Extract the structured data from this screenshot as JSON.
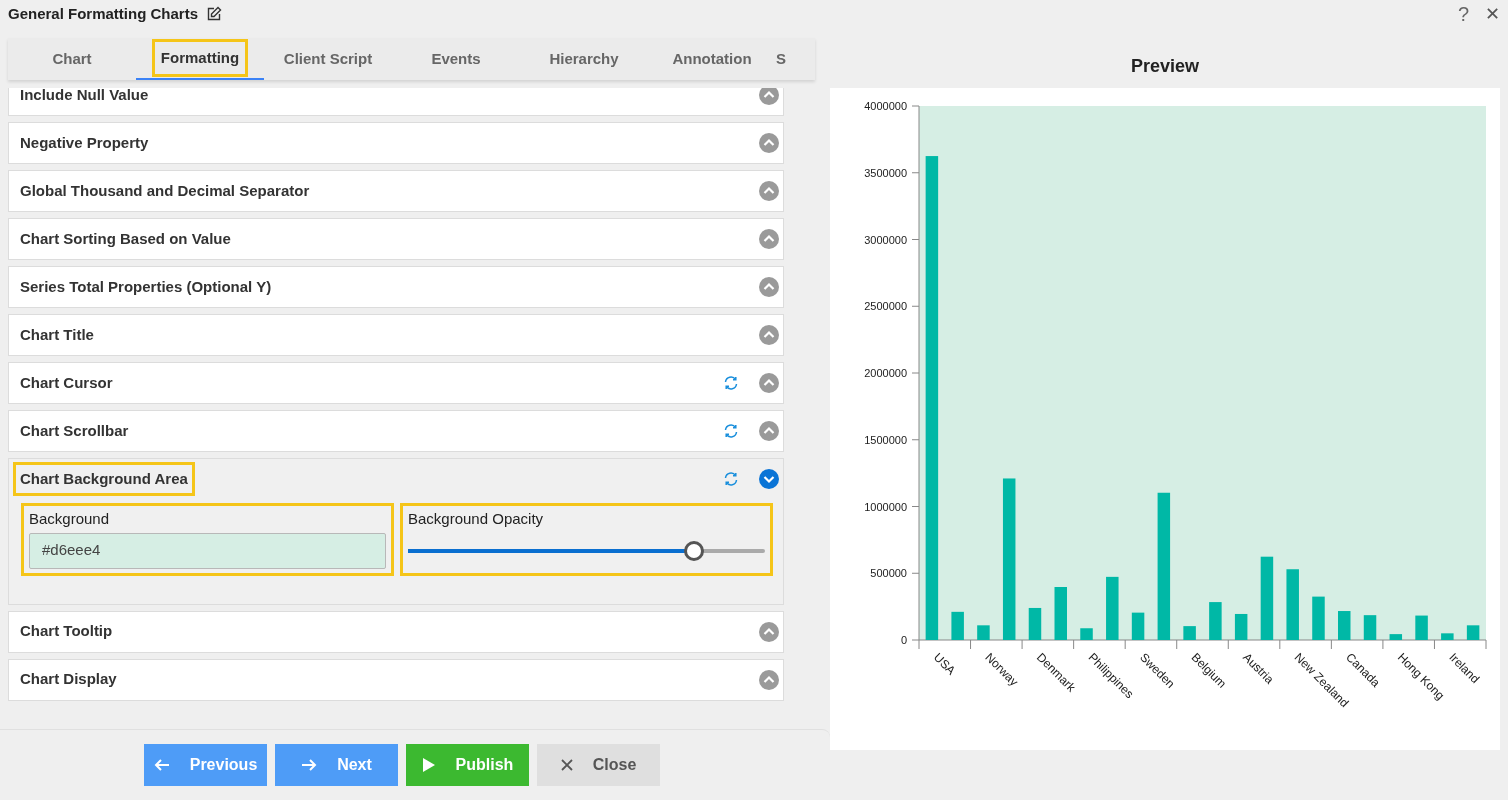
{
  "window": {
    "title": "General Formatting Charts",
    "help": "?",
    "close": "✕"
  },
  "tabs": [
    {
      "label": "Chart",
      "selected": false,
      "highlighted": false
    },
    {
      "label": "Formatting",
      "selected": true,
      "highlighted": true
    },
    {
      "label": "Client Script",
      "selected": false,
      "highlighted": false
    },
    {
      "label": "Events",
      "selected": false,
      "highlighted": false
    },
    {
      "label": "Hierarchy",
      "selected": false,
      "highlighted": false
    },
    {
      "label": "Annotation",
      "selected": false,
      "highlighted": false
    },
    {
      "label": "S",
      "selected": false,
      "highlighted": false
    }
  ],
  "sections": [
    {
      "title": "Include Null Value",
      "expanded": false,
      "resettable": false,
      "highlighted": false
    },
    {
      "title": "Negative Property",
      "expanded": false,
      "resettable": false,
      "highlighted": false
    },
    {
      "title": "Global Thousand and Decimal Separator",
      "expanded": false,
      "resettable": false,
      "highlighted": false
    },
    {
      "title": "Chart Sorting Based on Value",
      "expanded": false,
      "resettable": false,
      "highlighted": false
    },
    {
      "title": "Series Total Properties (Optional Y)",
      "expanded": false,
      "resettable": false,
      "highlighted": false
    },
    {
      "title": "Chart Title",
      "expanded": false,
      "resettable": false,
      "highlighted": false
    },
    {
      "title": "Chart Cursor",
      "expanded": false,
      "resettable": true,
      "highlighted": false
    },
    {
      "title": "Chart Scrollbar",
      "expanded": false,
      "resettable": true,
      "highlighted": false
    },
    {
      "title": "Chart Background Area",
      "expanded": true,
      "resettable": true,
      "highlighted": true,
      "fields": [
        {
          "kind": "color",
          "label": "Background",
          "value": "#d6eee4",
          "highlighted": true
        },
        {
          "kind": "slider",
          "label": "Background Opacity",
          "level": 0.8,
          "highlighted": true
        }
      ]
    },
    {
      "title": "Chart Tooltip",
      "expanded": false,
      "resettable": false,
      "highlighted": false
    },
    {
      "title": "Chart Display",
      "expanded": false,
      "resettable": false,
      "highlighted": false
    }
  ],
  "buttons": [
    {
      "kind": "previous",
      "label": "Previous"
    },
    {
      "kind": "next",
      "label": "Next"
    },
    {
      "kind": "publish",
      "label": "Publish"
    },
    {
      "kind": "close",
      "label": "Close"
    }
  ],
  "preview": {
    "title": "Preview",
    "chart_data": {
      "type": "bar",
      "categories": [
        "USA",
        "Norway",
        "Denmark",
        "Philippines",
        "Sweden",
        "Belgium",
        "Austria",
        "New Zealand",
        "Canada",
        "Hong Kong",
        "Ireland"
      ],
      "series": [
        {
          "color": "#00b8a6",
          "values": [
            3625000,
            110000,
            240000,
            88000,
            205000,
            104000,
            195000,
            530000,
            217000,
            44000,
            50000
          ]
        },
        {
          "color": "#00b8a6",
          "values": [
            211000,
            1210000,
            397000,
            473000,
            1103000,
            284000,
            624000,
            325000,
            186000,
            183000,
            110000
          ]
        }
      ],
      "ylim": [
        0,
        4000000
      ],
      "yticks": [
        0,
        500000,
        1000000,
        1500000,
        2000000,
        2500000,
        3000000,
        3500000,
        4000000
      ]
    }
  }
}
